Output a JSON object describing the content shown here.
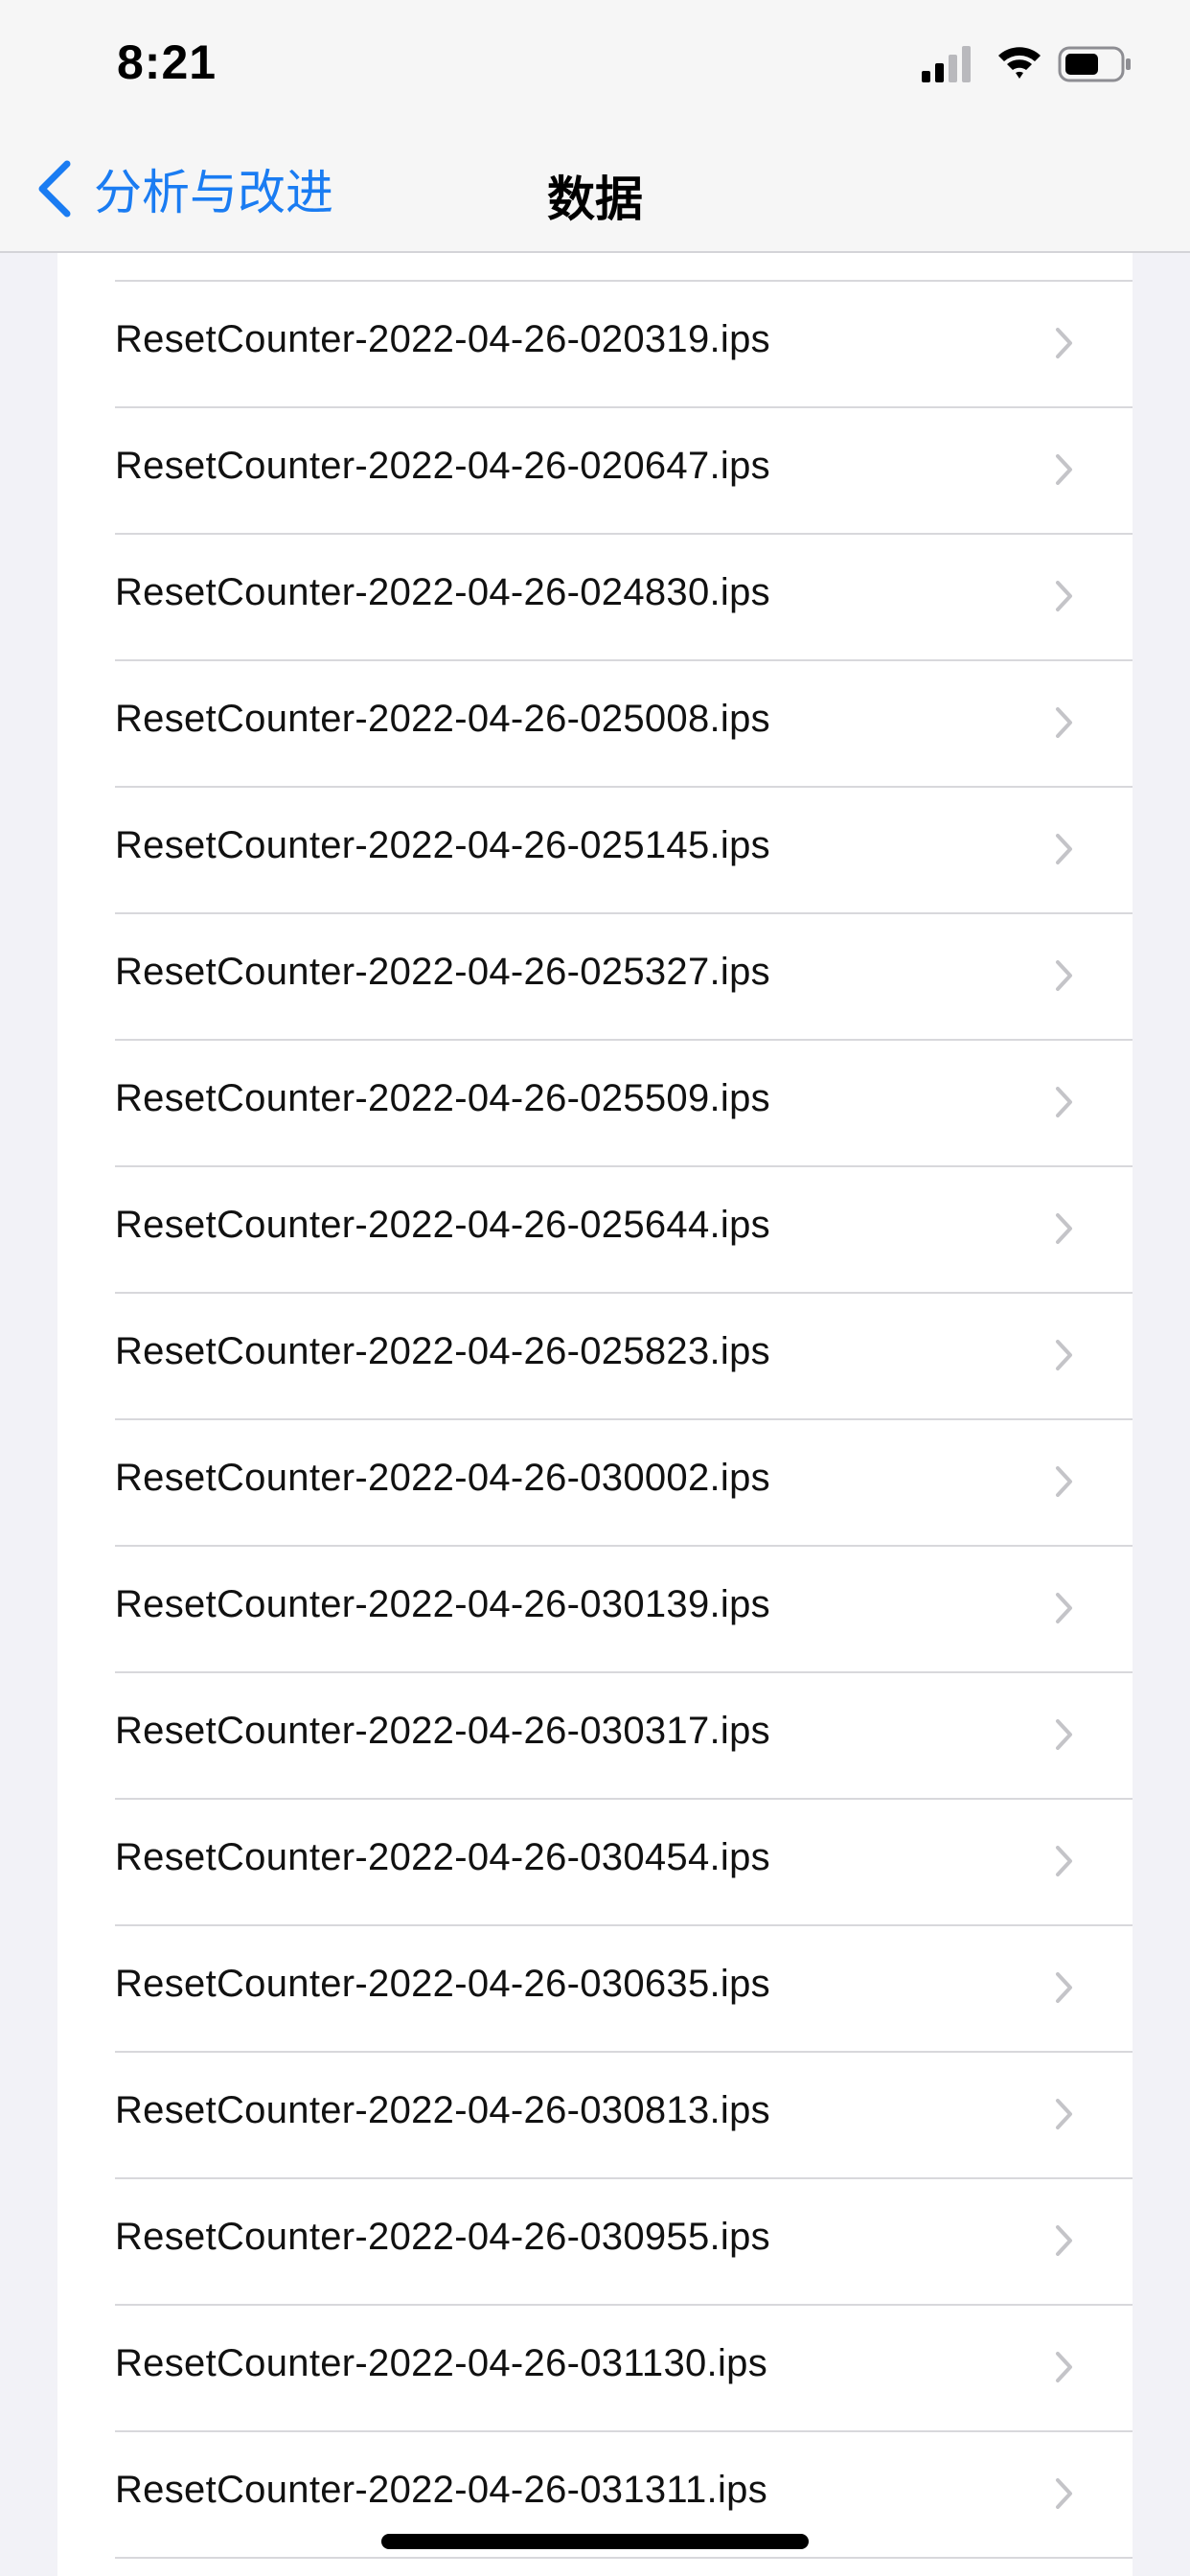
{
  "status_bar": {
    "time": "8:21"
  },
  "nav": {
    "back_label": "分析与改进",
    "title": "数据"
  },
  "files": [
    "ResetCounter-2022-04-26-020319.ips",
    "ResetCounter-2022-04-26-020647.ips",
    "ResetCounter-2022-04-26-024830.ips",
    "ResetCounter-2022-04-26-025008.ips",
    "ResetCounter-2022-04-26-025145.ips",
    "ResetCounter-2022-04-26-025327.ips",
    "ResetCounter-2022-04-26-025509.ips",
    "ResetCounter-2022-04-26-025644.ips",
    "ResetCounter-2022-04-26-025823.ips",
    "ResetCounter-2022-04-26-030002.ips",
    "ResetCounter-2022-04-26-030139.ips",
    "ResetCounter-2022-04-26-030317.ips",
    "ResetCounter-2022-04-26-030454.ips",
    "ResetCounter-2022-04-26-030635.ips",
    "ResetCounter-2022-04-26-030813.ips",
    "ResetCounter-2022-04-26-030955.ips",
    "ResetCounter-2022-04-26-031130.ips",
    "ResetCounter-2022-04-26-031311.ips"
  ],
  "colors": {
    "accent": "#1a7cf2",
    "background": "#f2f2f7",
    "separator": "#d8d8dc",
    "chevron": "#c4c4c8"
  },
  "icons": {
    "back": "chevron-left-icon",
    "row": "chevron-right-icon",
    "signal": "cellular-signal-icon",
    "wifi": "wifi-icon",
    "battery": "battery-icon"
  }
}
